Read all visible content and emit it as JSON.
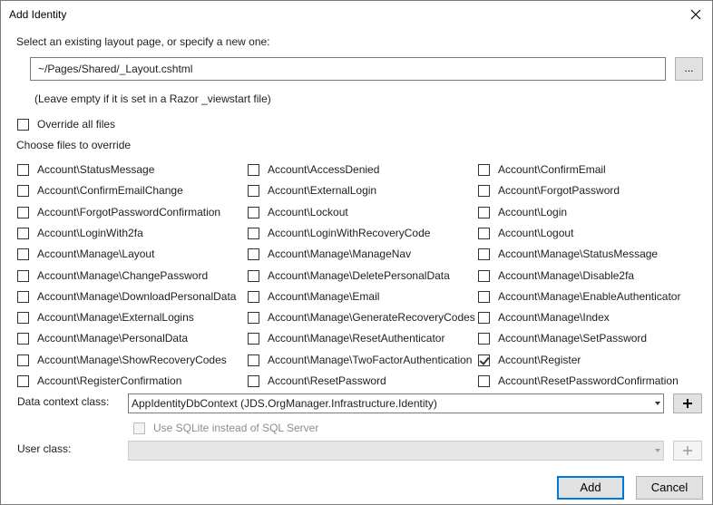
{
  "window": {
    "title": "Add Identity"
  },
  "layout": {
    "label": "Select an existing layout page, or specify a new one:",
    "path_value": "~/Pages/Shared/_Layout.cshtml",
    "browse_label": "...",
    "hint": "(Leave empty if it is set in a Razor _viewstart file)"
  },
  "override_all": {
    "label": "Override all files",
    "checked": false
  },
  "choose_files_label": "Choose files to override",
  "files": [
    [
      "Account\\StatusMessage",
      "Account\\AccessDenied",
      "Account\\ConfirmEmail"
    ],
    [
      "Account\\ConfirmEmailChange",
      "Account\\ExternalLogin",
      "Account\\ForgotPassword"
    ],
    [
      "Account\\ForgotPasswordConfirmation",
      "Account\\Lockout",
      "Account\\Login"
    ],
    [
      "Account\\LoginWith2fa",
      "Account\\LoginWithRecoveryCode",
      "Account\\Logout"
    ],
    [
      "Account\\Manage\\Layout",
      "Account\\Manage\\ManageNav",
      "Account\\Manage\\StatusMessage"
    ],
    [
      "Account\\Manage\\ChangePassword",
      "Account\\Manage\\DeletePersonalData",
      "Account\\Manage\\Disable2fa"
    ],
    [
      "Account\\Manage\\DownloadPersonalData",
      "Account\\Manage\\Email",
      "Account\\Manage\\EnableAuthenticator"
    ],
    [
      "Account\\Manage\\ExternalLogins",
      "Account\\Manage\\GenerateRecoveryCodes",
      "Account\\Manage\\Index"
    ],
    [
      "Account\\Manage\\PersonalData",
      "Account\\Manage\\ResetAuthenticator",
      "Account\\Manage\\SetPassword"
    ],
    [
      "Account\\Manage\\ShowRecoveryCodes",
      "Account\\Manage\\TwoFactorAuthentication",
      "Account\\Register"
    ],
    [
      "Account\\RegisterConfirmation",
      "Account\\ResetPassword",
      "Account\\ResetPasswordConfirmation"
    ]
  ],
  "checked_files": [
    "Account\\Register"
  ],
  "data_context": {
    "label": "Data context class:",
    "value": "AppIdentityDbContext (JDS.OrgManager.Infrastructure.Identity)",
    "add_label": "+"
  },
  "sqlite": {
    "label": "Use SQLite instead of SQL Server",
    "checked": false,
    "enabled": false
  },
  "user_class": {
    "label": "User class:",
    "value": "",
    "add_label": "+"
  },
  "buttons": {
    "add": "Add",
    "cancel": "Cancel"
  },
  "colors": {
    "accent": "#0078d7",
    "button_bg": "#e1e1e1",
    "border": "#7a7a7a"
  }
}
